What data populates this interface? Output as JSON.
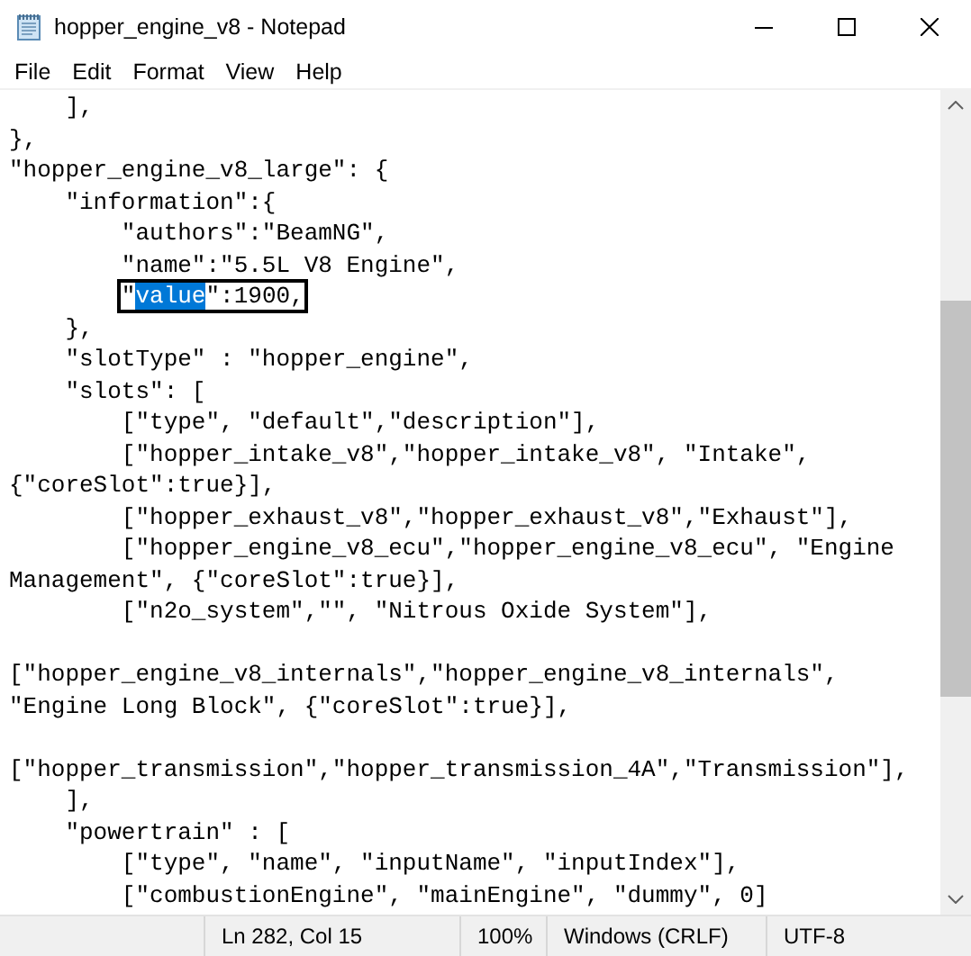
{
  "window": {
    "title": "hopper_engine_v8 - Notepad"
  },
  "menu": [
    "File",
    "Edit",
    "Format",
    "View",
    "Help"
  ],
  "editor": {
    "lines": [
      {
        "parts": [
          {
            "text": "    ],"
          }
        ]
      },
      {
        "parts": [
          {
            "text": "},"
          }
        ]
      },
      {
        "parts": [
          {
            "text": "\"hopper_engine_v8_large\": {"
          }
        ]
      },
      {
        "parts": [
          {
            "text": "    \"information\":{"
          }
        ]
      },
      {
        "parts": [
          {
            "text": "        \"authors\":\"BeamNG\","
          }
        ]
      },
      {
        "parts": [
          {
            "text": "        \"name\":\"5.5L V8 Engine\","
          }
        ]
      },
      {
        "indented": true,
        "parts": [
          {
            "text": "\"",
            "boxed": true
          },
          {
            "text": "value",
            "selected": true,
            "boxed": true
          },
          {
            "text": "\":1900,",
            "boxed": true
          }
        ]
      },
      {
        "parts": [
          {
            "text": "    },"
          }
        ]
      },
      {
        "parts": [
          {
            "text": "    \"slotType\" : \"hopper_engine\","
          }
        ]
      },
      {
        "parts": [
          {
            "text": "    \"slots\": ["
          }
        ]
      },
      {
        "parts": [
          {
            "text": "        [\"type\", \"default\",\"description\"],"
          }
        ]
      },
      {
        "parts": [
          {
            "text": "        [\"hopper_intake_v8\",\"hopper_intake_v8\", \"Intake\","
          }
        ]
      },
      {
        "parts": [
          {
            "text": "{\"coreSlot\":true}],"
          }
        ]
      },
      {
        "parts": [
          {
            "text": "        [\"hopper_exhaust_v8\",\"hopper_exhaust_v8\",\"Exhaust\"],"
          }
        ]
      },
      {
        "parts": [
          {
            "text": "        [\"hopper_engine_v8_ecu\",\"hopper_engine_v8_ecu\", \"Engine"
          }
        ]
      },
      {
        "parts": [
          {
            "text": "Management\", {\"coreSlot\":true}],"
          }
        ]
      },
      {
        "parts": [
          {
            "text": "        [\"n2o_system\",\"\", \"Nitrous Oxide System\"],"
          }
        ]
      },
      {
        "gap_before": true,
        "parts": [
          {
            "text": "[\"hopper_engine_v8_internals\",\"hopper_engine_v8_internals\","
          }
        ]
      },
      {
        "parts": [
          {
            "text": "\"Engine Long Block\", {\"coreSlot\":true}],"
          }
        ]
      },
      {
        "gap_before": true,
        "parts": [
          {
            "text": "[\"hopper_transmission\",\"hopper_transmission_4A\",\"Transmission\"],"
          }
        ]
      },
      {
        "parts": [
          {
            "text": "    ],"
          }
        ]
      },
      {
        "parts": [
          {
            "text": "    \"powertrain\" : ["
          }
        ]
      },
      {
        "parts": [
          {
            "text": "        [\"type\", \"name\", \"inputName\", \"inputIndex\"],"
          }
        ]
      },
      {
        "parts": [
          {
            "text": "        [\"combustionEngine\", \"mainEngine\", \"dummy\", 0]"
          }
        ]
      }
    ]
  },
  "status_bar": [
    "Ln 282, Col 15",
    "100%",
    "Windows (CRLF)",
    "UTF-8"
  ]
}
